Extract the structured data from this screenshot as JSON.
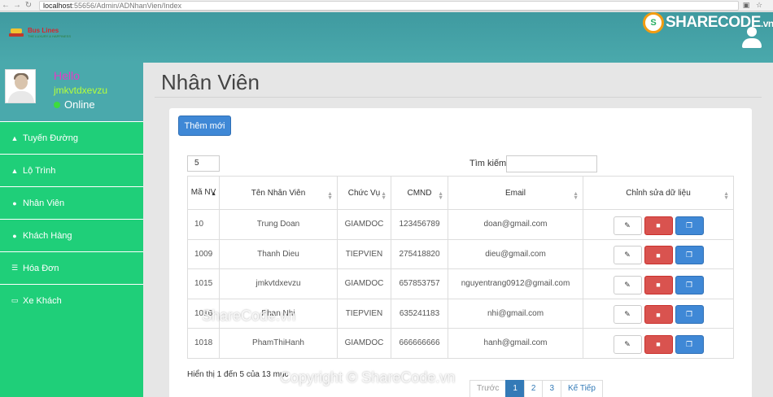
{
  "browser": {
    "host": "localhost",
    "path": ":55656/Admin/ADNhanVien/Index"
  },
  "header": {
    "logo_text": "Bus Lines",
    "logo_subtext": "THE LUXURY & HAPPINESS",
    "sharecode_logo": "SHARECODE",
    "sharecode_tld": ".vn"
  },
  "profile": {
    "hello": "Hello",
    "username": "jmkvtdxevzu",
    "status": "Online"
  },
  "sidebar": {
    "items": [
      {
        "label": "Tuyến Đường",
        "icon": "bus-icon"
      },
      {
        "label": "Lộ Trình",
        "icon": "bus-icon"
      },
      {
        "label": "Nhân Viên",
        "icon": "user-icon"
      },
      {
        "label": "Khách Hàng",
        "icon": "user-icon"
      },
      {
        "label": "Hóa Đơn",
        "icon": "list-icon"
      },
      {
        "label": "Xe Khách",
        "icon": "card-icon"
      }
    ]
  },
  "main": {
    "title": "Nhân Viên",
    "add_button": "Thêm mới",
    "page_size": "5",
    "search_label": "Tìm kiếm:",
    "columns": [
      "Mã NV",
      "Tên Nhân Viên",
      "Chức Vụ",
      "CMND",
      "Email",
      "Chỉnh sửa dữ liệu"
    ],
    "rows": [
      {
        "id": "10",
        "name": "Trung Doan",
        "role": "GIAMDOC",
        "cmnd": "123456789",
        "email": "doan@gmail.com"
      },
      {
        "id": "1009",
        "name": "Thanh Dieu",
        "role": "TIEPVIEN",
        "cmnd": "275418820",
        "email": "dieu@gmail.com"
      },
      {
        "id": "1015",
        "name": "jmkvtdxevzu",
        "role": "GIAMDOC",
        "cmnd": "657853757",
        "email": "nguyentrang0912@gmail.com"
      },
      {
        "id": "1016",
        "name": "Phan Nhi",
        "role": "TIEPVIEN",
        "cmnd": "635241183",
        "email": "nhi@gmail.com"
      },
      {
        "id": "1018",
        "name": "PhamThiHanh",
        "role": "GIAMDOC",
        "cmnd": "666666666",
        "email": "hanh@gmail.com"
      }
    ],
    "info": "Hiển thị 1 đến 5 của 13 mục",
    "pagination": {
      "prev": "Trước",
      "pages": [
        "1",
        "2",
        "3"
      ],
      "next": "Kế Tiếp",
      "current": "1"
    }
  },
  "watermarks": {
    "a": "ShareCode.vn",
    "b": "Copyright © ShareCode.vn"
  },
  "colors": {
    "header_teal": "#4aa9ac",
    "sidebar_green": "#1fcf79",
    "primary_blue": "#3f88d6",
    "danger_red": "#d9534f"
  }
}
